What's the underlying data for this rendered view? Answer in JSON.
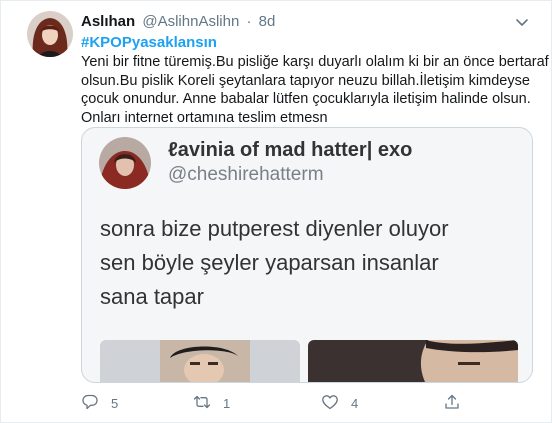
{
  "tweet": {
    "author_name": "Aslıhan",
    "author_handle": "@AslihnAslihn",
    "separator": "·",
    "time": "8d",
    "hashtag": "#KPOPyasaklansın",
    "text_lines": [
      "Yeni bir fitne türemiş.Bu pisliğe karşı duyarlı olalım ki bir an önce bertaraf",
      "olsun.Bu pislik Koreli şeytanlara tapıyor neuzu billah.İletişim kimdeyse",
      "çocuk onundur. Anne babalar lütfen çocuklarıyla iletişim halinde olsun.",
      "Onları internet ortamına teslim etmesn"
    ]
  },
  "quoted": {
    "name": "ℓavinia of mad hatter| exo",
    "handle": "@cheshirehatterm",
    "text_lines": [
      "sonra bize putperest diyenler oluyor",
      "sen böyle şeyler yaparsan insanlar",
      "sana tapar"
    ]
  },
  "actions": {
    "reply_count": "5",
    "retweet_count": "1",
    "like_count": "4"
  },
  "icons": {
    "caret": "chevron-down-icon",
    "reply": "reply-icon",
    "retweet": "retweet-icon",
    "like": "heart-icon",
    "share": "share-icon"
  },
  "colors": {
    "link": "#1da1f2",
    "secondary_text": "#657786",
    "border": "#e6ecf0"
  }
}
